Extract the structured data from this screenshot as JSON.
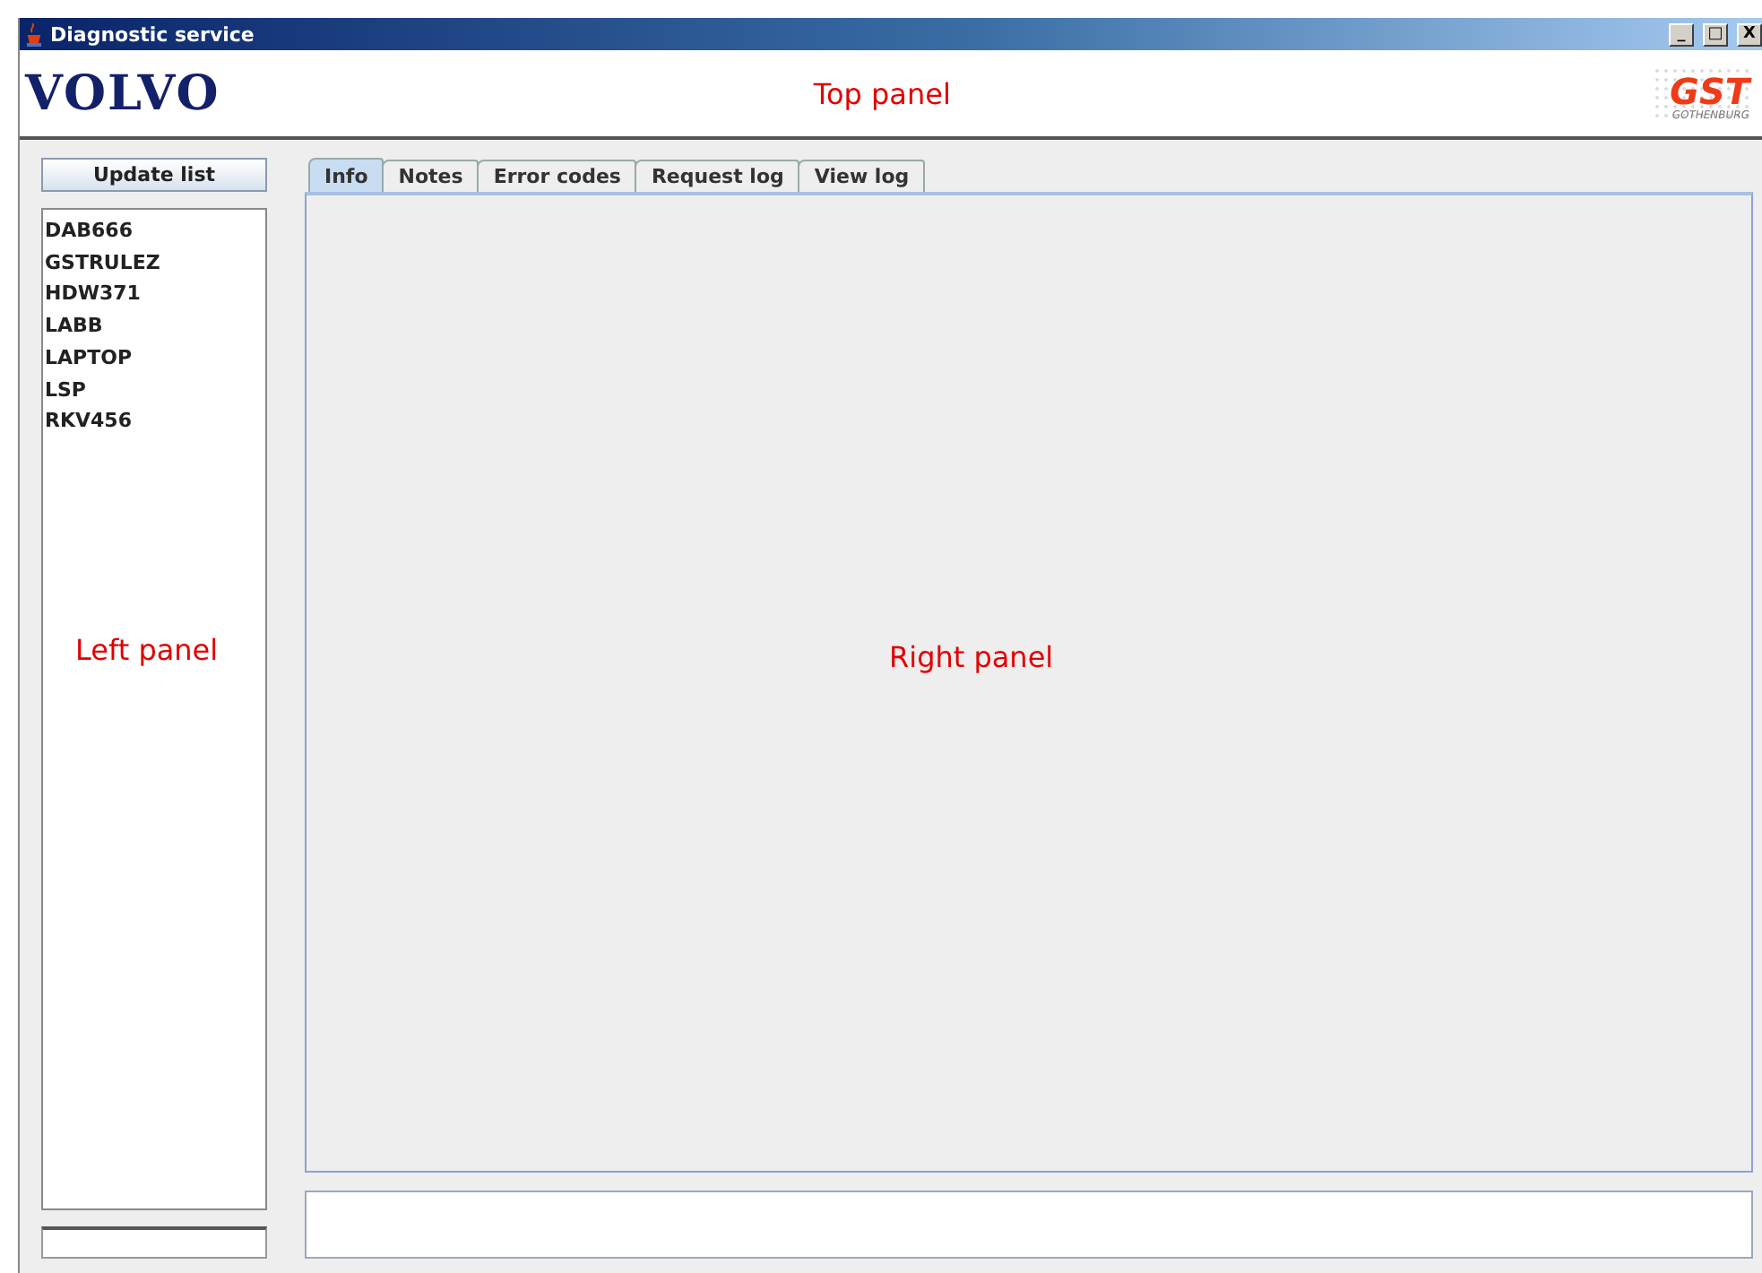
{
  "window": {
    "title": "Diagnostic service",
    "controls": [
      "_",
      "□",
      "X"
    ]
  },
  "top_panel": {
    "logo": "VOLVO",
    "label": "Top panel",
    "badge": "GST",
    "badge_caption": "GOTHENBURG"
  },
  "left_panel": {
    "button": "Update list",
    "items": [
      {
        "label": "DAB666",
        "selected": false
      },
      {
        "label": "GSTRULEZ",
        "selected": false
      },
      {
        "label": "HDW371",
        "selected": false
      },
      {
        "label": "LABB",
        "selected": false
      },
      {
        "label": "LAPTOP",
        "selected": false
      },
      {
        "label": "LSP",
        "selected": false
      },
      {
        "label": "RKV456",
        "selected": false
      }
    ],
    "label": "Left panel"
  },
  "right_panel": {
    "tabs": [
      {
        "label": "Info",
        "selected": true
      },
      {
        "label": "Notes",
        "selected": false
      },
      {
        "label": "Error codes",
        "selected": false
      },
      {
        "label": "Request log",
        "selected": false
      },
      {
        "label": "View log",
        "selected": false
      }
    ],
    "label": "Right panel"
  }
}
